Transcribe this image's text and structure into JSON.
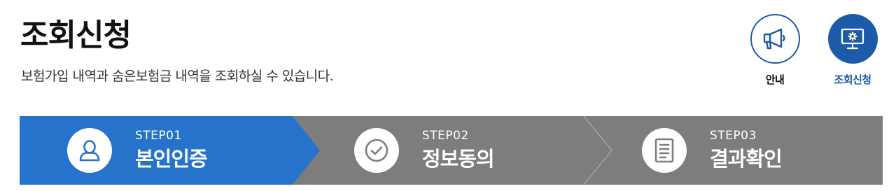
{
  "header": {
    "title": "조회신청",
    "description": "보험가입 내역과 숨은보험금 내역을 조회하실 수 있습니다."
  },
  "quick_menu": {
    "guide_label": "안내",
    "inquiry_label": "조회신청"
  },
  "steps": [
    {
      "number": "STEP01",
      "name": "본인인증",
      "icon": "user-icon",
      "active": true
    },
    {
      "number": "STEP02",
      "name": "정보동의",
      "icon": "check-circle-icon",
      "active": false
    },
    {
      "number": "STEP03",
      "name": "결과확인",
      "icon": "document-icon",
      "active": false
    }
  ],
  "colors": {
    "primary": "#1d5ba8",
    "step_active": "#2673cc",
    "step_inactive": "#7d7d7d"
  }
}
